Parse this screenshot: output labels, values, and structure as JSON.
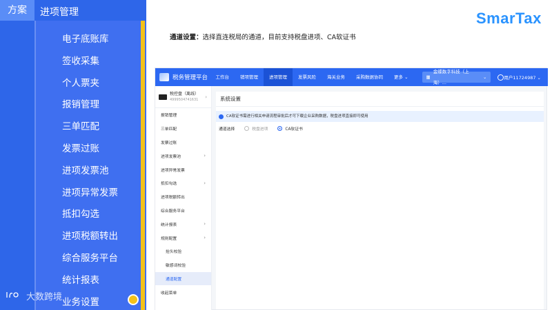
{
  "left_panel": {
    "tab_primary": "方案",
    "tab_secondary": "进项管理",
    "menu": [
      "电子底账库",
      "签收采集",
      "个人票夹",
      "报销管理",
      "三单匹配",
      "发票过账",
      "进项发票池",
      "进项异常发票",
      "抵扣勾选",
      "进项税额转出",
      "综合服务平台",
      "统计报表",
      "业务设置"
    ],
    "watermark": "大数跨境",
    "colors": {
      "panel": "#3f6ff0",
      "accent": "#f4c21a"
    }
  },
  "brand": {
    "logo_text": "SmarTax",
    "color": "#2a93ff"
  },
  "caption": {
    "label": "通道设置：",
    "text": "选择直连税局的通道，目前支持税盘进项、CA软证书"
  },
  "app": {
    "title": "税务管理平台",
    "nav": [
      "工作台",
      "销项管理",
      "进项管理",
      "发票风险",
      "海关业务",
      "采购数据协同",
      "更多"
    ],
    "active_nav": "进项管理",
    "company": "金蝶数字科技（上海）...",
    "user": "用户11724987",
    "account": {
      "name": "税控盘（离线）",
      "code": "4999504741631"
    },
    "sidebar": [
      {
        "label": "报销管理",
        "arrow": false
      },
      {
        "label": "三单匹配",
        "arrow": false
      },
      {
        "label": "发票过账",
        "arrow": false
      },
      {
        "label": "进项发票池",
        "arrow": true
      },
      {
        "label": "进项异常发票",
        "arrow": false
      },
      {
        "label": "抵扣勾选",
        "arrow": true
      },
      {
        "label": "进项税额转出",
        "arrow": false
      },
      {
        "label": "综合服务平台",
        "arrow": false
      },
      {
        "label": "统计报表",
        "arrow": true
      },
      {
        "label": "规则配置",
        "arrow": true
      },
      {
        "label": "抬头校验",
        "sub": true
      },
      {
        "label": "敏感词校验",
        "sub": true
      },
      {
        "label": "通道配置",
        "sub": true,
        "selected": true
      },
      {
        "label": "收起菜单",
        "arrow": false
      }
    ],
    "content": {
      "title": "系统设置",
      "notice": "CA软证书需进行相关申请流程审批后才可下载企业采购数据，税盘进项直接即可使用",
      "channel_label": "通道选择",
      "options": [
        {
          "label": "税盘进项",
          "checked": false
        },
        {
          "label": "CA软证书",
          "checked": true
        }
      ]
    }
  }
}
